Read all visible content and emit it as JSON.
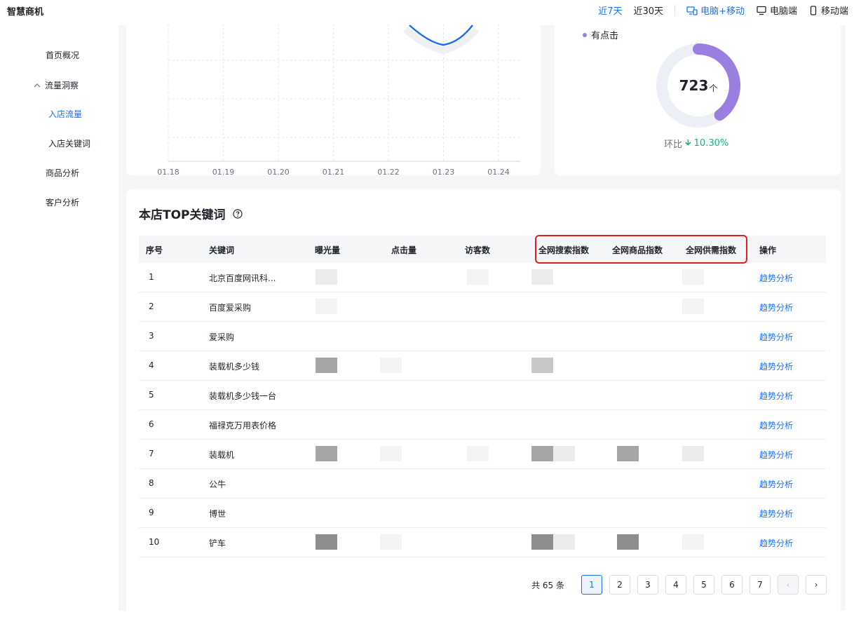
{
  "brand": "智慧商机",
  "topnav": {
    "range_7": "近7天",
    "range_30": "近30天",
    "device_all": "电脑+移动",
    "device_pc": "电脑端",
    "device_mobile": "移动端"
  },
  "sidebar": {
    "items": [
      {
        "label": "首页概况"
      },
      {
        "label": "流量洞察"
      },
      {
        "label": "入店流量"
      },
      {
        "label": "入店关键词"
      },
      {
        "label": "商品分析"
      },
      {
        "label": "客户分析"
      }
    ]
  },
  "line_chart": {
    "x_ticks": [
      "01.18",
      "01.19",
      "01.20",
      "01.21",
      "01.22",
      "01.23",
      "01.24"
    ],
    "line_color": "#1d6ff2"
  },
  "donut": {
    "legend": "有点击",
    "value": "723",
    "unit": "个",
    "fill_fraction": 0.4,
    "color": "#9b7fe0",
    "ratio_label": "环比",
    "ratio_value": "10.30%",
    "ratio_color": "#14b37d"
  },
  "table": {
    "title": "本店TOP关键词",
    "headers": {
      "index": "序号",
      "keyword": "关键词",
      "exposure": "曝光量",
      "clicks": "点击量",
      "visitors": "访客数",
      "search_index": "全网搜索指数",
      "product_index": "全网商品指数",
      "supply_index": "全网供需指数",
      "action": "操作"
    },
    "action_label": "趋势分析",
    "rows": [
      {
        "index": "1",
        "keyword": "北京百度网讯科..."
      },
      {
        "index": "2",
        "keyword": "百度爱采购"
      },
      {
        "index": "3",
        "keyword": "爱采购"
      },
      {
        "index": "4",
        "keyword": "装载机多少钱"
      },
      {
        "index": "5",
        "keyword": "装载机多少钱一台"
      },
      {
        "index": "6",
        "keyword": "福禄克万用表价格"
      },
      {
        "index": "7",
        "keyword": "装载机"
      },
      {
        "index": "8",
        "keyword": "公牛"
      },
      {
        "index": "9",
        "keyword": "博世"
      },
      {
        "index": "10",
        "keyword": "铲车"
      }
    ]
  },
  "pager": {
    "total": "共 65 条",
    "pages": [
      "1",
      "2",
      "3",
      "4",
      "5",
      "6",
      "7"
    ],
    "current": "1",
    "prev": "‹",
    "next": "›"
  }
}
